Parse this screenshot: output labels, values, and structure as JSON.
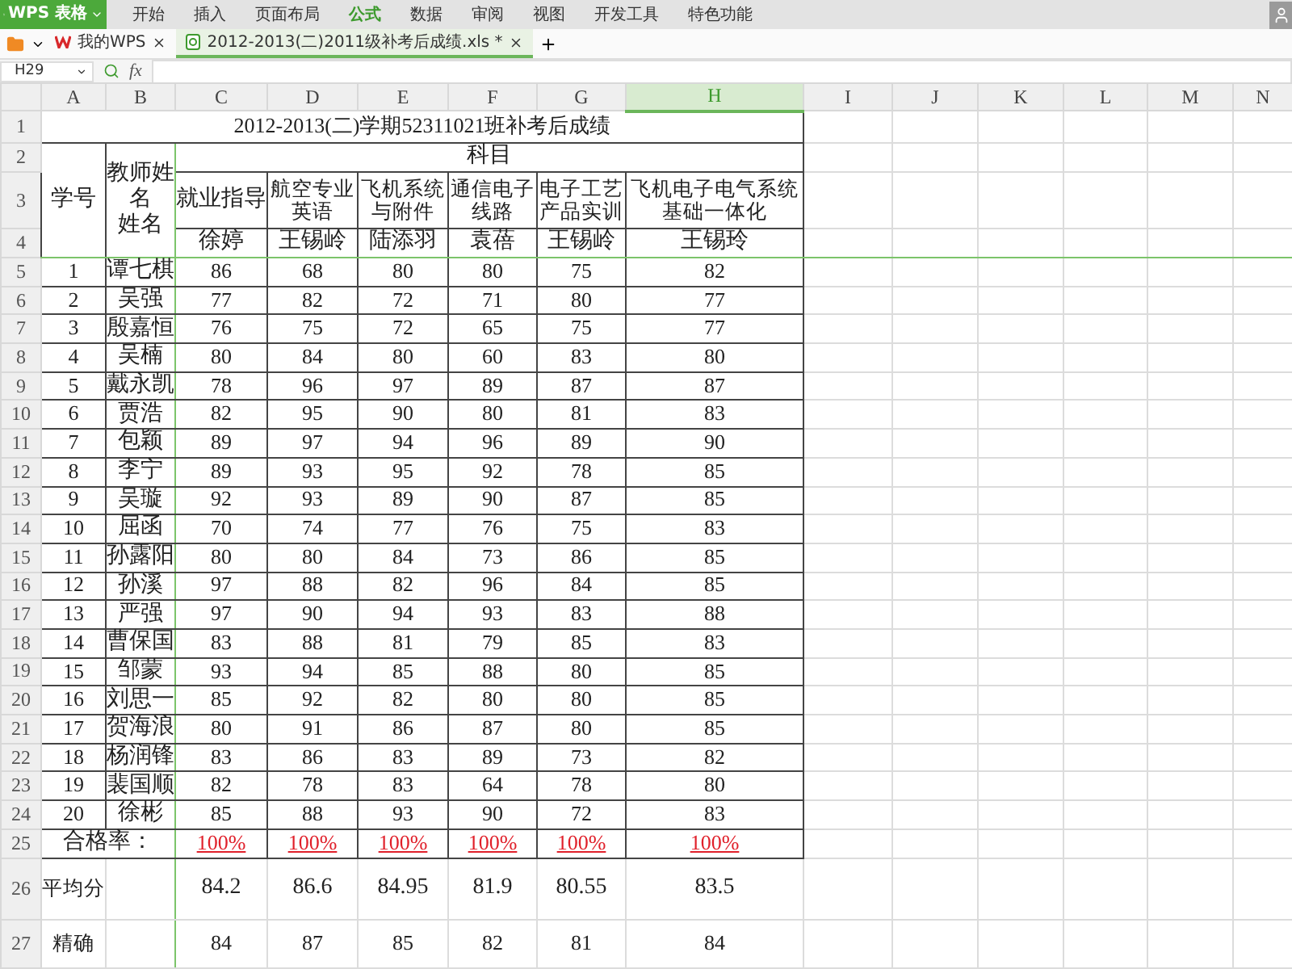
{
  "menu_bar": {
    "app_button": "WPS 表格",
    "items": [
      {
        "label": "开始",
        "selected": false
      },
      {
        "label": "插入",
        "selected": false
      },
      {
        "label": "页面布局",
        "selected": false
      },
      {
        "label": "公式",
        "selected": true
      },
      {
        "label": "数据",
        "selected": false
      },
      {
        "label": "审阅",
        "selected": false
      },
      {
        "label": "视图",
        "selected": false
      },
      {
        "label": "开发工具",
        "selected": false
      },
      {
        "label": "特色功能",
        "selected": false
      }
    ]
  },
  "tabs": [
    {
      "label": "我的WPS",
      "selected": false
    },
    {
      "label": "2012-2013(二)2011级补考后成绩.xls *",
      "selected": true
    }
  ],
  "formula_bar": {
    "name_box": "H29",
    "function_label": "fx"
  },
  "columns": [
    {
      "label": "A",
      "selected": false
    },
    {
      "label": "B",
      "selected": false
    },
    {
      "label": "C",
      "selected": false
    },
    {
      "label": "D",
      "selected": false
    },
    {
      "label": "E",
      "selected": false
    },
    {
      "label": "F",
      "selected": false
    },
    {
      "label": "G",
      "selected": false
    },
    {
      "label": "H",
      "selected": true
    },
    {
      "label": "I",
      "selected": false
    },
    {
      "label": "J",
      "selected": false
    },
    {
      "label": "K",
      "selected": false
    },
    {
      "label": "L",
      "selected": false
    },
    {
      "label": "M",
      "selected": false
    },
    {
      "label": "N",
      "selected": false
    }
  ],
  "row_numbers": [
    "1",
    "2",
    "3",
    "4",
    "5",
    "6",
    "7",
    "8",
    "9",
    "10",
    "11",
    "12",
    "13",
    "14",
    "15",
    "16",
    "17",
    "18",
    "19",
    "20",
    "21",
    "22",
    "23",
    "24",
    "25",
    "26",
    "27"
  ],
  "sheet": {
    "title": "2012-2013(二)学期52311021班补考后成绩",
    "student_id_header": "学号",
    "teacher_header": [
      "教师姓名",
      "姓名"
    ],
    "subjects_header": "科目",
    "subjects": [
      {
        "name": "就业指导",
        "teacher": "徐婷"
      },
      {
        "name": "航空专业英语",
        "teacher": "王锡岭"
      },
      {
        "name": "飞机系统与附件",
        "teacher": "陆添羽"
      },
      {
        "name": "通信电子线路",
        "teacher": "袁蓓"
      },
      {
        "name": "电子工艺产品实训",
        "teacher": "王锡岭"
      },
      {
        "name": "飞机电子电气系统基础一体化",
        "teacher": "王锡玲"
      }
    ],
    "students": [
      {
        "id": "1",
        "name": "谭七棋",
        "scores": [
          "86",
          "68",
          "80",
          "80",
          "75",
          "82"
        ]
      },
      {
        "id": "2",
        "name": "吴强",
        "scores": [
          "77",
          "82",
          "72",
          "71",
          "80",
          "77"
        ]
      },
      {
        "id": "3",
        "name": "殷嘉恒",
        "scores": [
          "76",
          "75",
          "72",
          "65",
          "75",
          "77"
        ]
      },
      {
        "id": "4",
        "name": "吴楠",
        "scores": [
          "80",
          "84",
          "80",
          "60",
          "83",
          "80"
        ]
      },
      {
        "id": "5",
        "name": "戴永凯",
        "scores": [
          "78",
          "96",
          "97",
          "89",
          "87",
          "87"
        ]
      },
      {
        "id": "6",
        "name": "贾浩",
        "scores": [
          "82",
          "95",
          "90",
          "80",
          "81",
          "83"
        ]
      },
      {
        "id": "7",
        "name": "包颖",
        "scores": [
          "89",
          "97",
          "94",
          "96",
          "89",
          "90"
        ]
      },
      {
        "id": "8",
        "name": "李宁",
        "scores": [
          "89",
          "93",
          "95",
          "92",
          "78",
          "85"
        ]
      },
      {
        "id": "9",
        "name": "吴璇",
        "scores": [
          "92",
          "93",
          "89",
          "90",
          "87",
          "85"
        ]
      },
      {
        "id": "10",
        "name": "屈函",
        "scores": [
          "70",
          "74",
          "77",
          "76",
          "75",
          "83"
        ]
      },
      {
        "id": "11",
        "name": "孙露阳",
        "scores": [
          "80",
          "80",
          "84",
          "73",
          "86",
          "85"
        ]
      },
      {
        "id": "12",
        "name": "孙溪",
        "scores": [
          "97",
          "88",
          "82",
          "96",
          "84",
          "85"
        ]
      },
      {
        "id": "13",
        "name": "严强",
        "scores": [
          "97",
          "90",
          "94",
          "93",
          "83",
          "88"
        ]
      },
      {
        "id": "14",
        "name": "曹保国",
        "scores": [
          "83",
          "88",
          "81",
          "79",
          "85",
          "83"
        ]
      },
      {
        "id": "15",
        "name": "邹蒙",
        "scores": [
          "93",
          "94",
          "85",
          "88",
          "80",
          "85"
        ]
      },
      {
        "id": "16",
        "name": "刘思一",
        "scores": [
          "85",
          "92",
          "82",
          "80",
          "80",
          "85"
        ]
      },
      {
        "id": "17",
        "name": "贺海浪",
        "scores": [
          "80",
          "91",
          "86",
          "87",
          "80",
          "85"
        ]
      },
      {
        "id": "18",
        "name": "杨润锋",
        "scores": [
          "83",
          "86",
          "83",
          "89",
          "73",
          "82"
        ]
      },
      {
        "id": "19",
        "name": "裴国顺",
        "scores": [
          "82",
          "78",
          "83",
          "64",
          "78",
          "80"
        ]
      },
      {
        "id": "20",
        "name": "徐彬",
        "scores": [
          "85",
          "88",
          "93",
          "90",
          "72",
          "83"
        ]
      }
    ],
    "pass_rate": {
      "label": "合格率：",
      "values": [
        "100%",
        "100%",
        "100%",
        "100%",
        "100%",
        "100%"
      ]
    },
    "average": {
      "label": "平均分",
      "values": [
        "84.2",
        "86.6",
        "84.95",
        "81.9",
        "80.55",
        "83.5"
      ]
    },
    "rounded": {
      "label": "精确",
      "values": [
        "84",
        "87",
        "85",
        "82",
        "81",
        "84"
      ]
    }
  }
}
